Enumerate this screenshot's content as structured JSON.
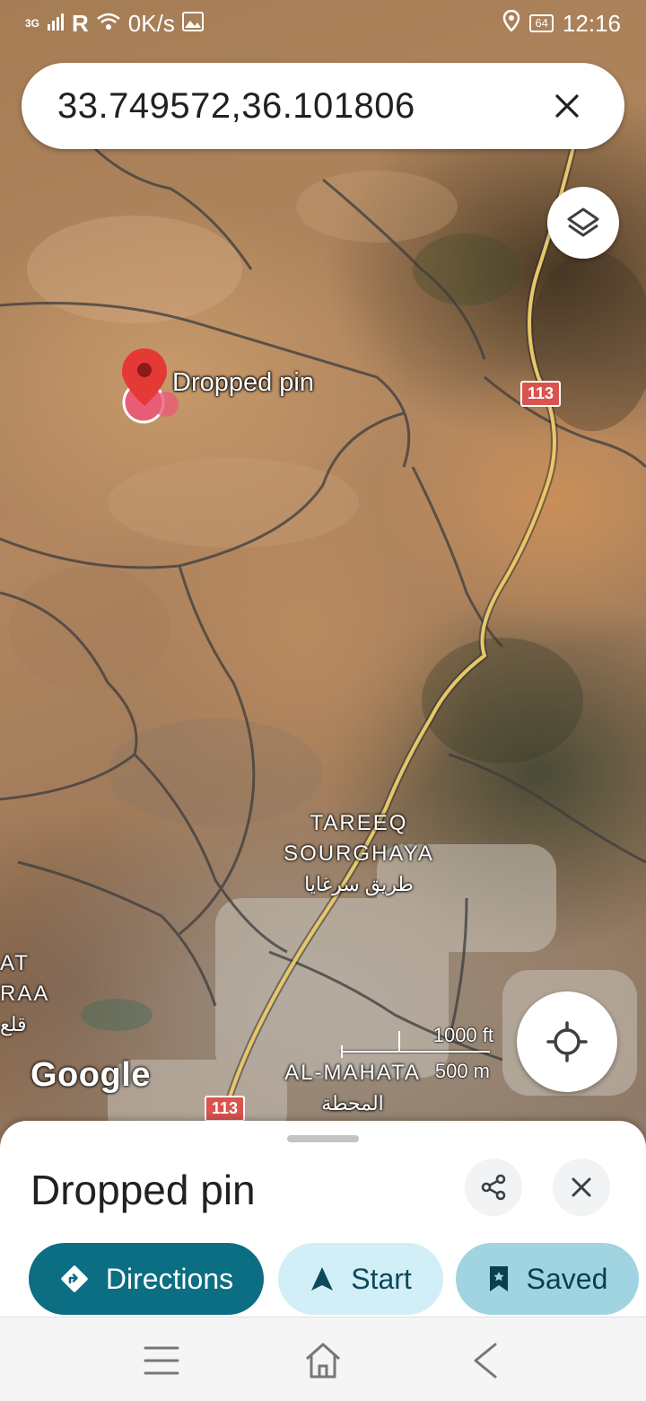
{
  "status_bar": {
    "network": "3G",
    "roaming": "R",
    "speed": "0K/s",
    "battery": "64",
    "time": "12:16"
  },
  "search": {
    "query": "33.749572,36.101806"
  },
  "map": {
    "pin_label": "Dropped pin",
    "route_shield_top": "113",
    "route_shield_bottom": "113",
    "place_1_line1": "TAREEQ",
    "place_1_line2": "SOURGHAYA",
    "place_1_arabic": "طريق سرغايا",
    "place_2_line1": "AL-MAHATA",
    "place_2_arabic": "المحطة",
    "place_3_line1": "AT",
    "place_3_line2": "RAA",
    "place_3_arabic": "قلع",
    "scale_ft": "1000 ft",
    "scale_m": "500 m",
    "logo": "Google"
  },
  "sheet": {
    "title": "Dropped pin",
    "directions_label": "Directions",
    "start_label": "Start",
    "saved_label": "Saved"
  },
  "icons": {
    "layers": "layers-icon",
    "locate": "my-location-icon",
    "share": "share-icon",
    "close": "close-icon",
    "directions": "directions-icon",
    "start": "navigation-arrow-icon",
    "saved": "bookmark-icon"
  },
  "colors": {
    "pin": "#e53935",
    "directions_bg": "#0b6e82",
    "start_bg": "#d2eef6",
    "saved_bg": "#9fd4e0",
    "road_major": "#e8c76a"
  }
}
